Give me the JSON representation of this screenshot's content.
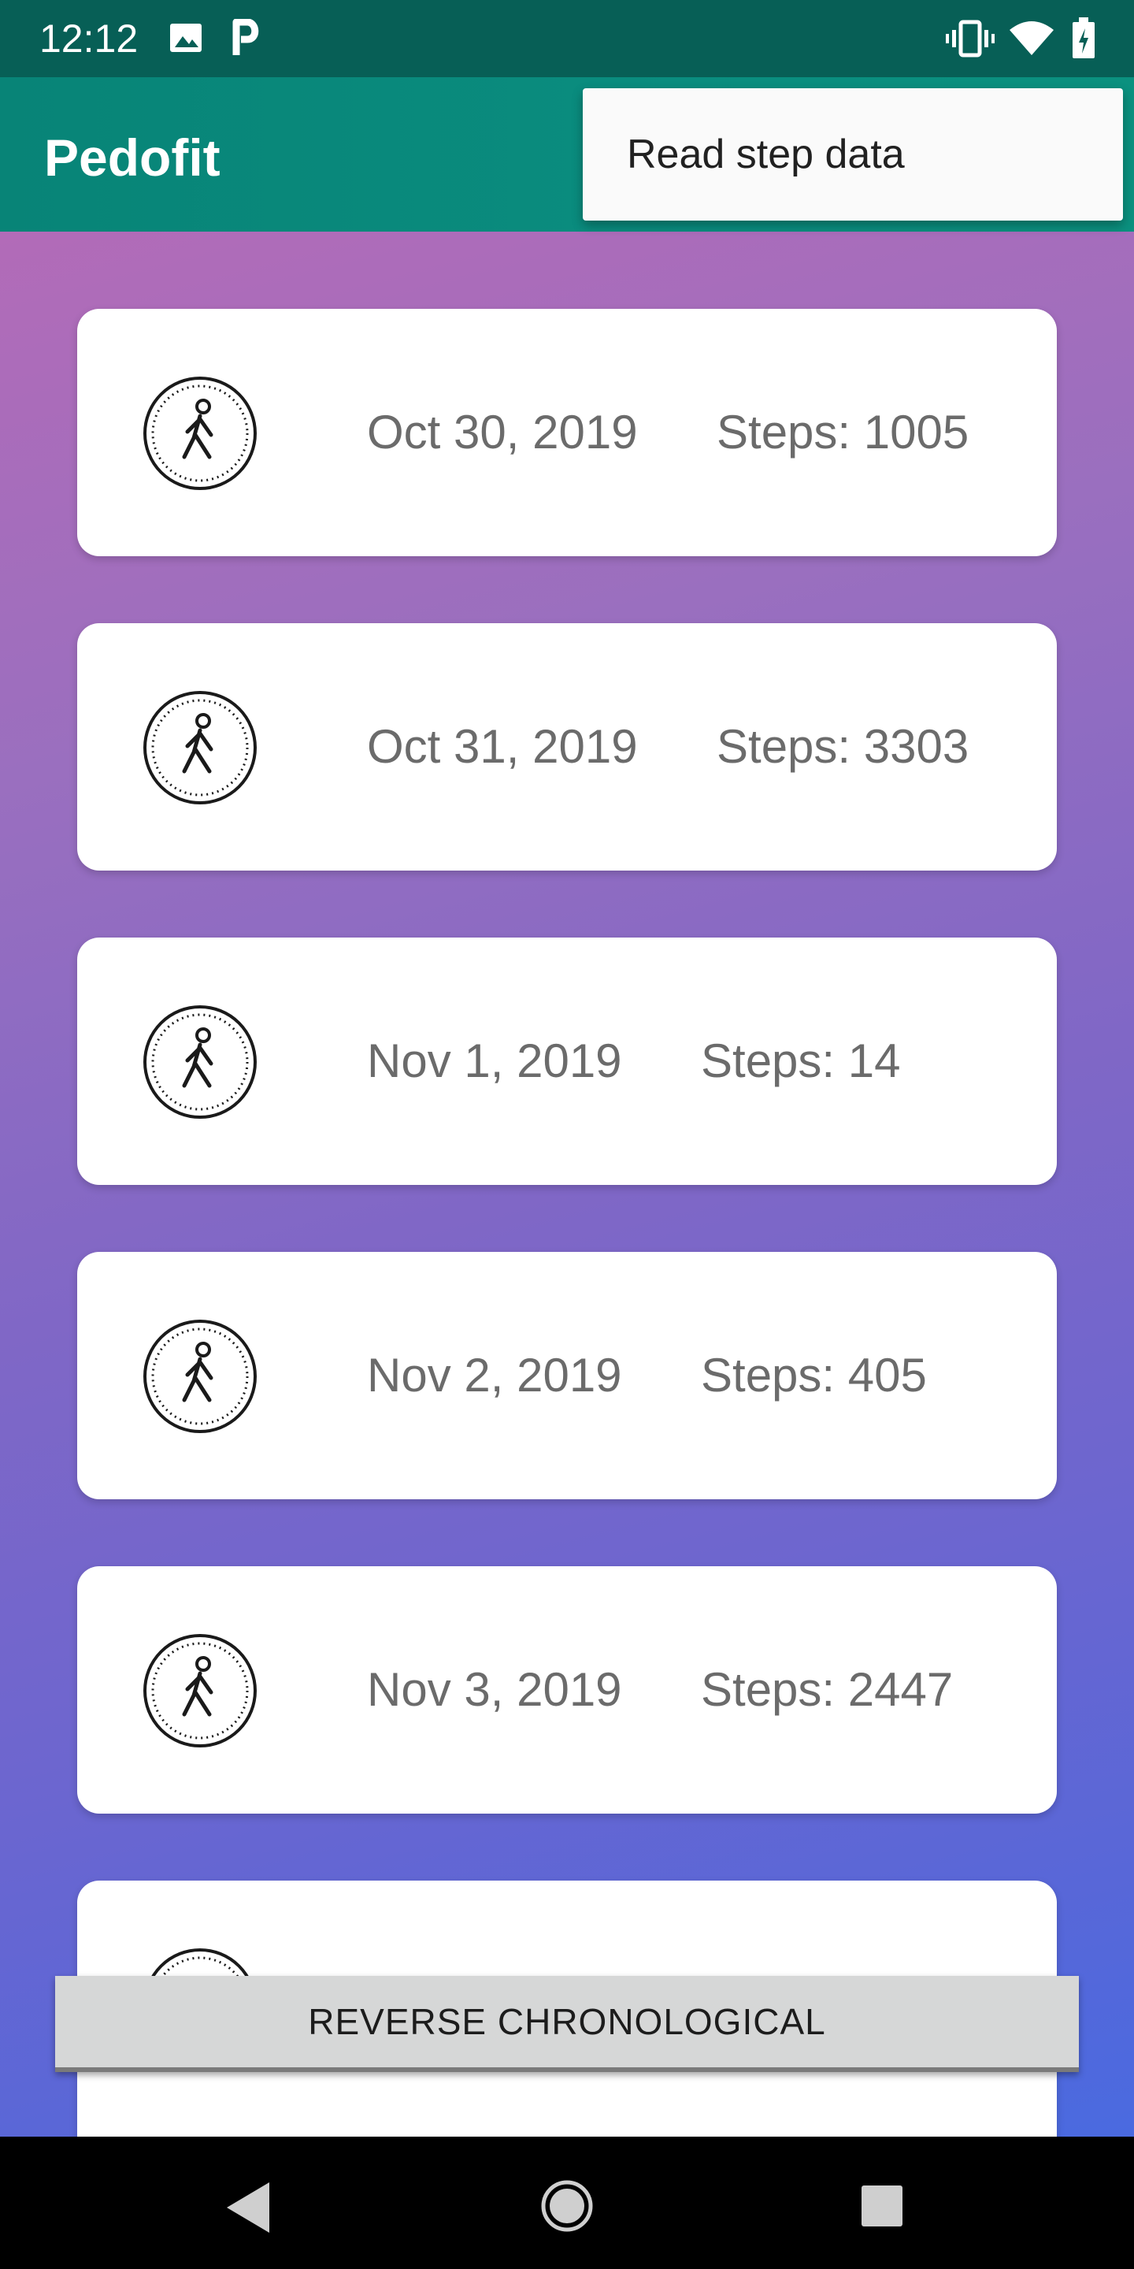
{
  "status_bar": {
    "time": "12:12",
    "icons": [
      "photo-icon",
      "p-icon",
      "vibrate-icon",
      "wifi-icon",
      "battery-icon"
    ]
  },
  "app_bar": {
    "title": "Pedofit"
  },
  "overflow_menu": {
    "items": [
      {
        "label": "Read step data"
      }
    ]
  },
  "step_list": {
    "icon": "walking-person-icon",
    "items": [
      {
        "date": "Oct 30, 2019",
        "steps": "Steps: 1005"
      },
      {
        "date": "Oct 31, 2019",
        "steps": "Steps: 3303"
      },
      {
        "date": "Nov 1, 2019",
        "steps": "Steps: 14"
      },
      {
        "date": "Nov 2, 2019",
        "steps": "Steps: 405"
      },
      {
        "date": "Nov 3, 2019",
        "steps": "Steps: 2447"
      }
    ]
  },
  "sort_button": {
    "label": "REVERSE CHRONOLOGICAL"
  },
  "nav_bar": {
    "icons": [
      "back-icon",
      "home-icon",
      "recents-icon"
    ]
  },
  "colors": {
    "status_bar": "#075f56",
    "app_bar": "#088477",
    "gradient_top": "#b26bb8",
    "gradient_bottom": "#4a6ae0",
    "card_text": "#6b6b6b"
  }
}
